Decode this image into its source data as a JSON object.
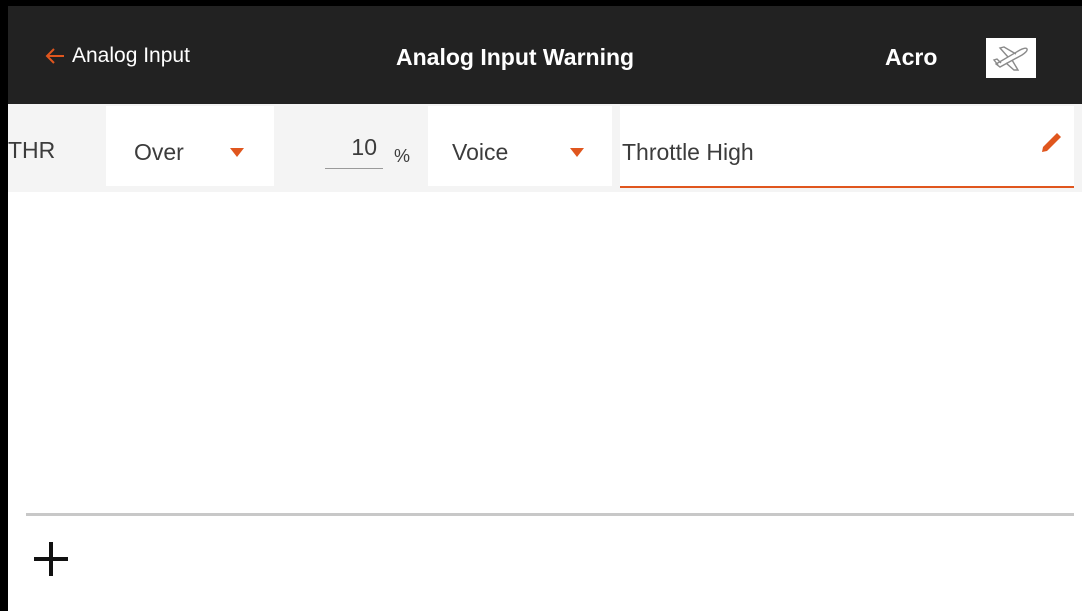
{
  "header": {
    "back_label": "Analog Input",
    "back_icon": "arrow-left-icon",
    "title": "Analog Input Warning",
    "model_name": "Acro",
    "model_icon": "airplane-icon"
  },
  "warning_row": {
    "channel": "THR",
    "condition": "Over",
    "value": "10",
    "unit": "%",
    "alert_type": "Voice",
    "message": "Throttle High",
    "edit_icon": "pencil-icon",
    "caret_icon": "chevron-down-icon"
  },
  "footer": {
    "add_icon": "plus-icon"
  },
  "colors": {
    "header_bg": "#222222",
    "accent": "#e0561e",
    "row_bg": "#f4f4f4",
    "text": "#3c3c3c"
  }
}
